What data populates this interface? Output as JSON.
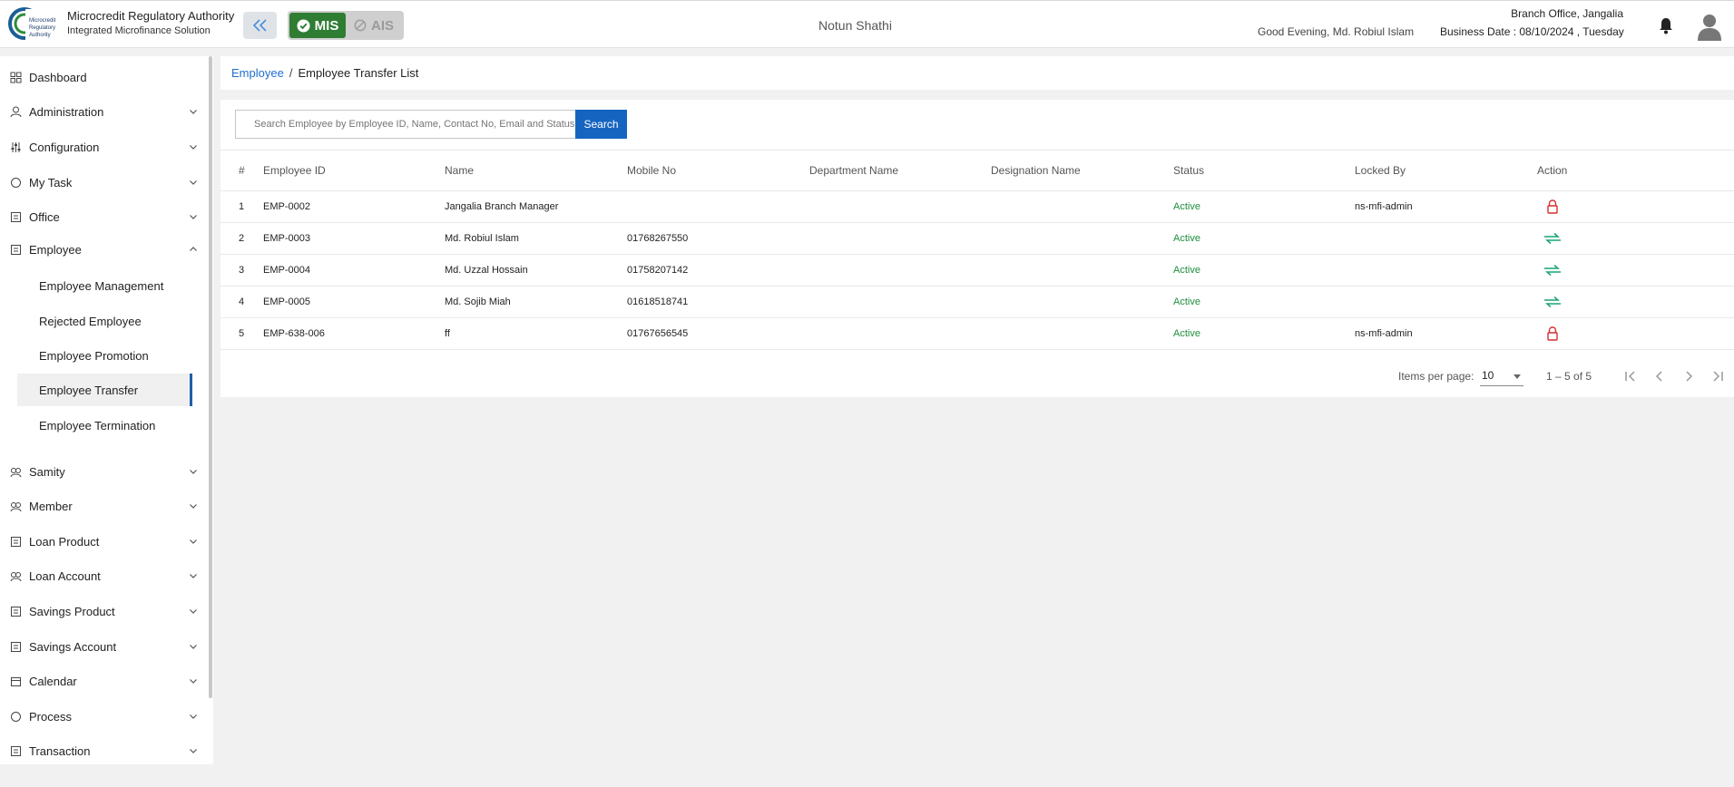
{
  "header": {
    "brand_title": "Microcredit Regulatory Authority",
    "brand_subtitle": "Integrated Microfinance Solution",
    "logo_text": "Microcredit Regulatory Authority",
    "mode_mis": "MIS",
    "mode_ais": "AIS",
    "center_title": "Notun Shathi",
    "greeting": "Good Evening, Md. Robiul Islam",
    "branch": "Branch Office, Jangalia",
    "business_date": "Business Date : 08/10/2024 , Tuesday"
  },
  "sidebar": {
    "items": [
      {
        "label": "Dashboard",
        "icon": "dashboard-icon"
      },
      {
        "label": "Administration",
        "icon": "admin-icon"
      },
      {
        "label": "Configuration",
        "icon": "config-icon"
      },
      {
        "label": "My Task",
        "icon": "task-icon"
      },
      {
        "label": "Office",
        "icon": "office-icon"
      },
      {
        "label": "Employee",
        "icon": "employee-icon"
      },
      {
        "label": "Samity",
        "icon": "samity-icon"
      },
      {
        "label": "Member",
        "icon": "member-icon"
      },
      {
        "label": "Loan Product",
        "icon": "loan-product-icon"
      },
      {
        "label": "Loan Account",
        "icon": "loan-account-icon"
      },
      {
        "label": "Savings Product",
        "icon": "savings-product-icon"
      },
      {
        "label": "Savings Account",
        "icon": "savings-account-icon"
      },
      {
        "label": "Calendar",
        "icon": "calendar-icon"
      },
      {
        "label": "Process",
        "icon": "process-icon"
      },
      {
        "label": "Transaction",
        "icon": "transaction-icon"
      }
    ],
    "employee_sub": [
      {
        "label": "Employee Management"
      },
      {
        "label": "Rejected Employee"
      },
      {
        "label": "Employee Promotion"
      },
      {
        "label": "Employee Transfer"
      },
      {
        "label": "Employee Termination"
      }
    ]
  },
  "breadcrumb": {
    "parent": "Employee",
    "separator": "/",
    "current": "Employee Transfer List"
  },
  "search": {
    "placeholder": "Search Employee by Employee ID, Name, Contact No, Email and Status",
    "button": "Search"
  },
  "table": {
    "headers": [
      "#",
      "Employee ID",
      "Name",
      "Mobile No",
      "Department Name",
      "Designation Name",
      "Status",
      "Locked By",
      "Action"
    ],
    "rows": [
      {
        "n": "1",
        "id": "EMP-0002",
        "name": "Jangalia Branch Manager",
        "mobile": "",
        "dept": "",
        "desig": "",
        "status": "Active",
        "locked_by": "ns-mfi-admin",
        "action": "lock-icon"
      },
      {
        "n": "2",
        "id": "EMP-0003",
        "name": "Md. Robiul Islam",
        "mobile": "01768267550",
        "dept": "",
        "desig": "",
        "status": "Active",
        "locked_by": "",
        "action": "transfer-icon"
      },
      {
        "n": "3",
        "id": "EMP-0004",
        "name": "Md. Uzzal Hossain",
        "mobile": "01758207142",
        "dept": "",
        "desig": "",
        "status": "Active",
        "locked_by": "",
        "action": "transfer-icon"
      },
      {
        "n": "4",
        "id": "EMP-0005",
        "name": "Md. Sojib Miah",
        "mobile": "01618518741",
        "dept": "",
        "desig": "",
        "status": "Active",
        "locked_by": "",
        "action": "transfer-icon"
      },
      {
        "n": "5",
        "id": "EMP-638-006",
        "name": "ff",
        "mobile": "01767656545",
        "dept": "",
        "desig": "",
        "status": "Active",
        "locked_by": "ns-mfi-admin",
        "action": "lock-icon"
      }
    ]
  },
  "paginator": {
    "items_per_page_label": "Items per page:",
    "items_per_page": "10",
    "range": "1 – 5 of 5"
  },
  "colors": {
    "accent": "#1565c0",
    "mis_active": "#2e7d32",
    "status_active": "#1e8e3e",
    "lock": "#d32f2f",
    "transfer": "#1aa37a"
  }
}
